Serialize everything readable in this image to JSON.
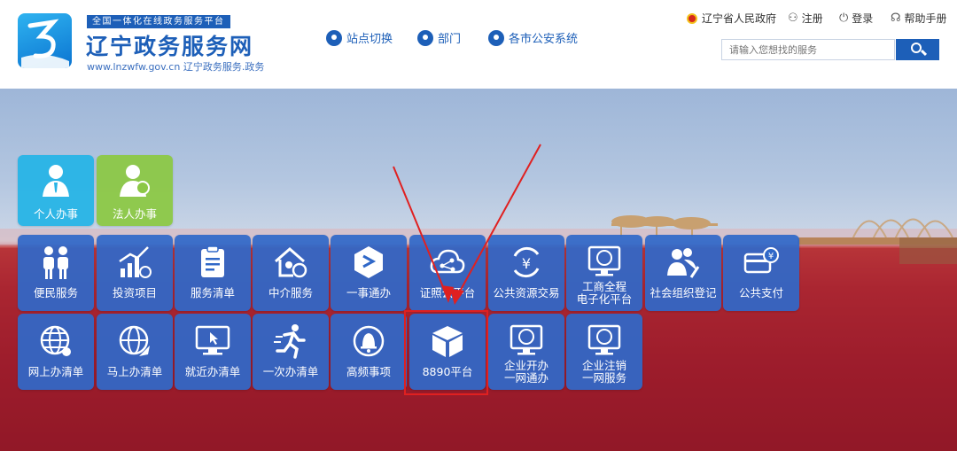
{
  "header": {
    "tagline": "全国一体化在线政务服务平台",
    "site_title": "辽宁政务服务网",
    "site_url": "www.lnzwfw.gov.cn  辽宁政务服务.政务",
    "nav": [
      {
        "label": "站点切换",
        "icon": "location-pin-icon"
      },
      {
        "label": "部门",
        "icon": "org-chart-icon"
      },
      {
        "label": "各市公安系统",
        "icon": "location-pin-icon"
      }
    ],
    "top_links": {
      "gov": "辽宁省人民政府",
      "register": "注册",
      "login": "登录",
      "help": "帮助手册"
    },
    "search": {
      "placeholder": "请输入您想找的服务"
    }
  },
  "categories": [
    {
      "label": "个人办事",
      "icon": "person-icon"
    },
    {
      "label": "法人办事",
      "icon": "legal-person-icon"
    }
  ],
  "tiles_row1": [
    {
      "label": "便民服务",
      "icon": "people-icon"
    },
    {
      "label": "投资项目",
      "icon": "investment-chart-icon"
    },
    {
      "label": "服务清单",
      "icon": "clipboard-icon"
    },
    {
      "label": "中介服务",
      "icon": "agency-icon"
    },
    {
      "label": "一事通办",
      "icon": "hexagon-link-icon"
    },
    {
      "label": "证照云平台",
      "icon": "cloud-share-icon"
    },
    {
      "label": "公共资源交易",
      "icon": "yuan-cycle-icon"
    },
    {
      "label": "工商全程\n电子化平台",
      "icon": "monitor-emblem-icon"
    },
    {
      "label": "社会组织登记",
      "icon": "group-edit-icon"
    },
    {
      "label": "公共支付",
      "icon": "card-pay-icon"
    }
  ],
  "tiles_row2": [
    {
      "label": "网上办清单",
      "icon": "globe-icon"
    },
    {
      "label": "马上办清单",
      "icon": "globe-rocket-icon"
    },
    {
      "label": "就近办清单",
      "icon": "monitor-cursor-icon"
    },
    {
      "label": "一次办清单",
      "icon": "running-man-icon"
    },
    {
      "label": "高频事项",
      "icon": "alarm-bell-icon"
    },
    {
      "label": "8890平台",
      "icon": "box-3d-icon"
    },
    {
      "label": "企业开办\n一网通办",
      "icon": "monitor-emblem-icon"
    },
    {
      "label": "企业注销\n一网服务",
      "icon": "monitor-emblem-icon"
    }
  ],
  "colors": {
    "brand_blue": "#1d5fb8",
    "tile_blue": "#3068c8",
    "highlight_red": "#e02020"
  }
}
